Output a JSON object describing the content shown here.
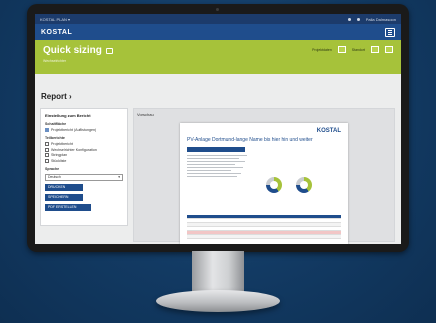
{
  "topbar": {
    "left": "KOSTAL PLAN ▾",
    "user": "Palla Dalmasoon"
  },
  "header": {
    "logo": "KOSTAL"
  },
  "banner": {
    "title": "Quick sizing",
    "subtitle": "Wechselrichter",
    "right_label_1": "Projektdaten",
    "right_label_2": "Standort"
  },
  "report": {
    "title": "Report ›"
  },
  "settings": {
    "heading": "Einstellung zum Bericht",
    "section1": "Schaltfläche",
    "section1_items": [
      "Projektbericht (Auflistungen)"
    ],
    "section2": "Teilberichte",
    "section2_items": [
      "Projektbericht",
      "Wechselrichter Konfiguration",
      "Stringplan",
      "Stückliste"
    ],
    "language_label": "Sprache",
    "language_value": "Deutsch",
    "btn1": "DRUCKEN",
    "btn2": "SPEICHERN",
    "btn3": "PDF ERSTELLEN"
  },
  "preview": {
    "label": "Vorschau",
    "doc_logo": "KOSTAL",
    "doc_heading": "PV-Anlage Dortmund-lange Name bis hier hin und weiter"
  }
}
